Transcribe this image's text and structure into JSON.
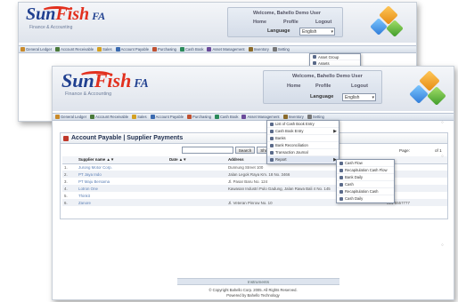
{
  "back_window": {
    "logo": {
      "sun": "Sun",
      "fish": "Fish",
      "fa": "FA",
      "subtitle": "Finance & Accounting"
    },
    "welcome": "Welcome, Bahello Demo User",
    "links": {
      "home": "Home",
      "profile": "Profile",
      "logout": "Logout"
    },
    "language_label": "Language",
    "language_value": "English",
    "menu": [
      "General Ledger",
      "Account Receivable",
      "Sales",
      "Account Payable",
      "Purchasing",
      "Cash Book",
      "Asset Management",
      "Inventory",
      "Setting"
    ],
    "dropdown": [
      "Asset Group",
      "Assets"
    ]
  },
  "front_window": {
    "logo": {
      "sun": "Sun",
      "fish": "Fish",
      "fa": "FA",
      "subtitle": "Finance & Accounting"
    },
    "welcome": "Welcome, Bahello Demo User",
    "links": {
      "home": "Home",
      "profile": "Profile",
      "logout": "Logout"
    },
    "language_label": "Language",
    "language_value": "English",
    "menu": [
      "General Ledger",
      "Account Receivable",
      "Sales",
      "Account Payable",
      "Purchasing",
      "Cash Book",
      "Asset Management",
      "Inventory",
      "Setting"
    ],
    "cashbook_menu": [
      {
        "label": "List of Cash Book Entry",
        "submenu": false
      },
      {
        "label": "Cash Book Entry",
        "submenu": true
      },
      {
        "label": "Banks",
        "submenu": false
      },
      {
        "label": "Bank Reconciliation",
        "submenu": false
      },
      {
        "label": "Transaction Journal",
        "submenu": false
      },
      {
        "label": "Report",
        "submenu": true
      }
    ],
    "report_menu": [
      "Cash Flow",
      "Recapitulation Cash Flow",
      "Bank Daily",
      "Cash",
      "Recapitulation Cash",
      "Cash Daily"
    ],
    "panel": {
      "title": "Account Payable | Supplier Payments",
      "search_button": "Search",
      "show_all_button": "Show All",
      "page_label": "Page:",
      "page_total": "of 1",
      "columns": [
        "",
        "Supplier name ▲▼",
        "Date ▲▼",
        "Address",
        ""
      ],
      "rows": [
        {
          "no": "1.",
          "name": "Jurong Motor Corp.",
          "date": "",
          "address": "Dunnung Street 100",
          "phone": ""
        },
        {
          "no": "2.",
          "name": "PT Jaya Indo",
          "date": "",
          "address": "Jalan Legok Raya Km. 18 No. 3466",
          "phone": ""
        },
        {
          "no": "3.",
          "name": "PT Maju Bersama",
          "date": "",
          "address": "Jl. Pasar Baru No. 124",
          "phone": ""
        },
        {
          "no": "4.",
          "name": "Lotron One",
          "date": "",
          "address": "Kawasan Industri Pulo Gadung, Jalan Rawa Bali 4 No. 145",
          "phone": ""
        },
        {
          "no": "5.",
          "name": "Thinkit",
          "date": "",
          "address": "",
          "phone": ""
        },
        {
          "no": "6.",
          "name": "Zanore",
          "date": "",
          "address": "Jl. Veteran Pinrow No. 10",
          "phone": "021-5557777"
        }
      ]
    },
    "footer_label": "Instruments",
    "copyright_line1": "© Copyright Bahello Corp. 2005. All Rights Reserved.",
    "copyright_line2": "Powered by Bahello Technology"
  },
  "colors": {
    "brand_blue": "#1f3f8f",
    "brand_red": "#e2301e",
    "link_blue": "#5b7fb5"
  }
}
